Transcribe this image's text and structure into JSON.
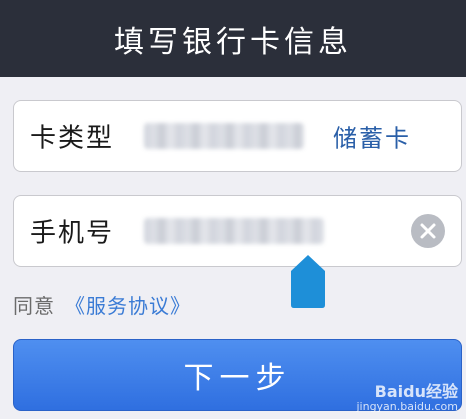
{
  "header": {
    "title": "填写银行卡信息"
  },
  "card_type_row": {
    "label": "卡类型",
    "card_kind": "储蓄卡"
  },
  "phone_row": {
    "label": "手机号"
  },
  "agreement": {
    "prefix": "同意",
    "link": "《服务协议》"
  },
  "next_button": {
    "label": "下一步"
  },
  "watermark": {
    "brand": "Baidu经验",
    "url": "jingyan.baidu.com"
  },
  "colors": {
    "header_bg": "#2b2f3a",
    "accent": "#3a7bd5",
    "button": "#2f6fe0",
    "marker": "#1e8fd8"
  }
}
